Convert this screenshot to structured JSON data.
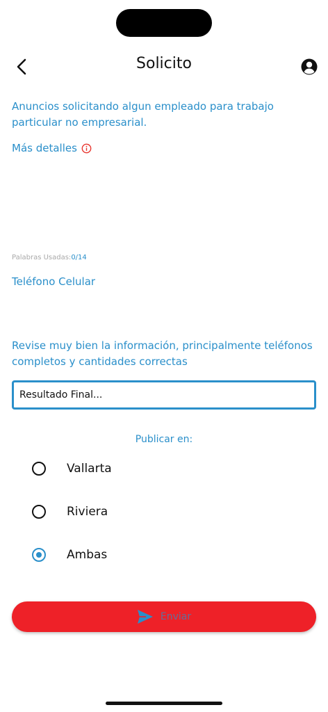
{
  "header": {
    "title": "Solicito",
    "back_icon": "chevron-left-icon",
    "profile_icon": "user-circle-icon"
  },
  "description": "Anuncios solicitando algun empleado para trabajo particular no empresarial.",
  "more_details": {
    "label": "Más detalles",
    "icon": "info-icon",
    "icon_color": "#e8362f"
  },
  "word_counter": {
    "label": "Palabras Usadas:",
    "value": "0/14"
  },
  "phone_label": "Teléfono Celular",
  "review_note": "Revise muy bien la información, principalmente teléfonos completos y cantidades correctas",
  "result": {
    "text": "Resultado Final..."
  },
  "publish": {
    "label": "Publicar en:",
    "options": [
      {
        "label": "Vallarta",
        "checked": false
      },
      {
        "label": "Riviera",
        "checked": false
      },
      {
        "label": "Ambas",
        "checked": true
      }
    ]
  },
  "send_button": {
    "label": "Enviar",
    "icon": "send-icon",
    "background": "#ee2128"
  },
  "colors": {
    "accent": "#2a8fca",
    "danger": "#ee2128",
    "text": "#111111"
  }
}
